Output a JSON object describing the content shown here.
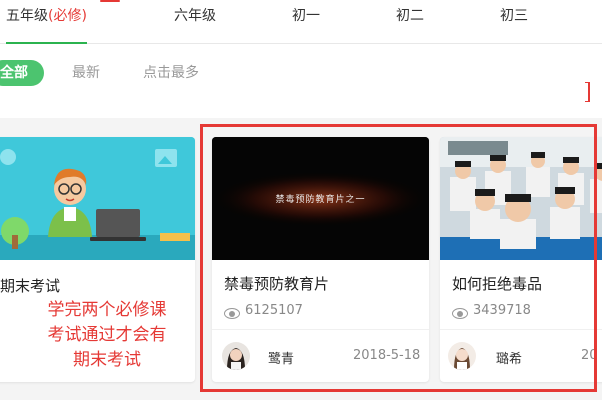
{
  "grade_tabs": [
    {
      "label": "五年级",
      "suffix": "(必修)",
      "active": true
    },
    {
      "label": "六年级",
      "active": false
    },
    {
      "label": "初一",
      "active": false
    },
    {
      "label": "初二",
      "active": false
    },
    {
      "label": "初三",
      "active": false
    }
  ],
  "filters": [
    {
      "label": "全部",
      "active": true
    },
    {
      "label": "最新",
      "active": false
    },
    {
      "label": "点击最多",
      "active": false
    }
  ],
  "cards": [
    {
      "title": "期末考试",
      "thumbnail": "teacher-at-laptop-illustration"
    },
    {
      "title": "禁毒预防教育片",
      "thumbnail_caption": "禁毒预防教育片之一",
      "views": "6125107",
      "author": "鹭青",
      "date": "2018-5-18"
    },
    {
      "title": "如何拒绝毒品",
      "thumbnail": "classroom-students-photo",
      "views": "3439718",
      "author": "璐希",
      "date": "20"
    }
  ],
  "annotation": {
    "text": "学完两个必修课\n考试通过才会有\n期末考试",
    "color": "#e53935"
  },
  "colors": {
    "accent_green": "#4cc46f",
    "required_red": "#e53935"
  }
}
